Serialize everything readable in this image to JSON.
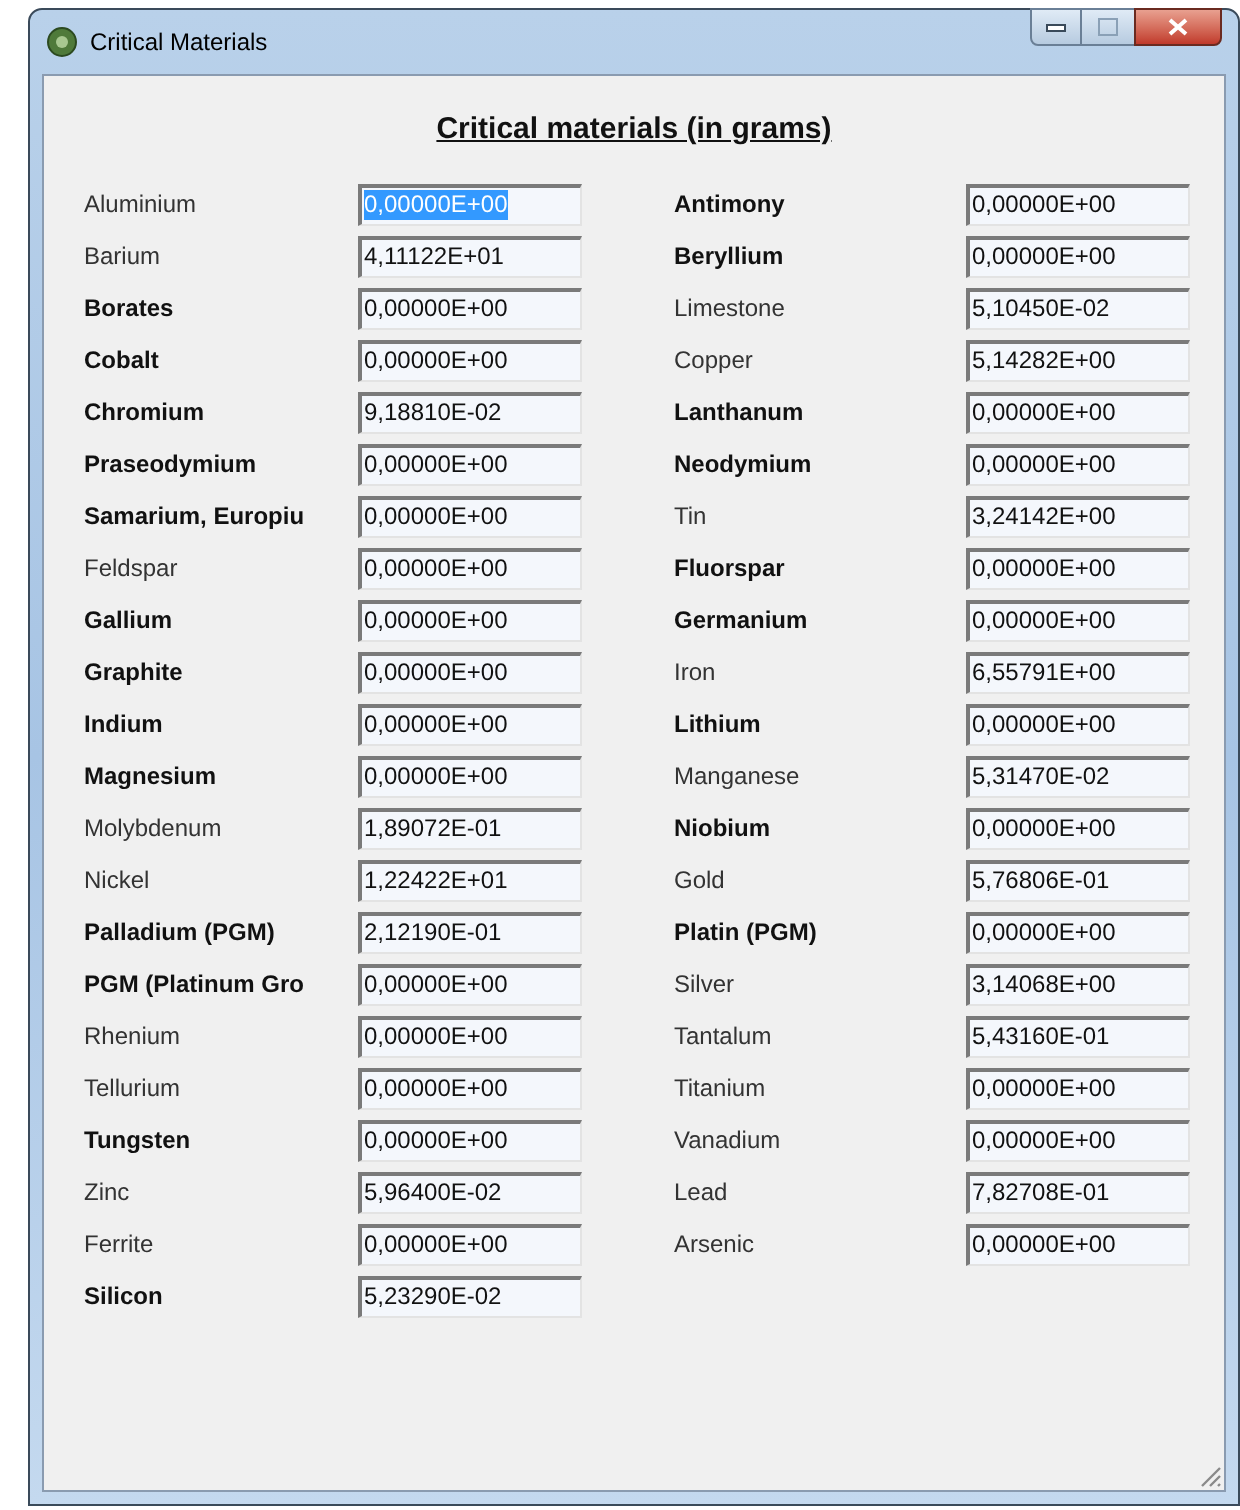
{
  "window": {
    "title": "Critical Materials"
  },
  "heading": "Critical materials (in grams)",
  "left_column": [
    {
      "name": "Aluminium",
      "bold": false,
      "value": "0,00000E+00",
      "selected": true
    },
    {
      "name": "Barium",
      "bold": false,
      "value": "4,11122E+01",
      "selected": false
    },
    {
      "name": "Borates",
      "bold": true,
      "value": "0,00000E+00",
      "selected": false
    },
    {
      "name": "Cobalt",
      "bold": true,
      "value": "0,00000E+00",
      "selected": false
    },
    {
      "name": "Chromium",
      "bold": true,
      "value": "9,18810E-02",
      "selected": false
    },
    {
      "name": "Praseodymium",
      "bold": true,
      "value": "0,00000E+00",
      "selected": false
    },
    {
      "name": "Samarium, Europiu",
      "bold": true,
      "value": "0,00000E+00",
      "selected": false
    },
    {
      "name": "Feldspar",
      "bold": false,
      "value": "0,00000E+00",
      "selected": false
    },
    {
      "name": "Gallium",
      "bold": true,
      "value": "0,00000E+00",
      "selected": false
    },
    {
      "name": "Graphite",
      "bold": true,
      "value": "0,00000E+00",
      "selected": false
    },
    {
      "name": "Indium",
      "bold": true,
      "value": "0,00000E+00",
      "selected": false
    },
    {
      "name": "Magnesium",
      "bold": true,
      "value": "0,00000E+00",
      "selected": false
    },
    {
      "name": "Molybdenum",
      "bold": false,
      "value": "1,89072E-01",
      "selected": false
    },
    {
      "name": "Nickel",
      "bold": false,
      "value": "1,22422E+01",
      "selected": false
    },
    {
      "name": "Palladium (PGM)",
      "bold": true,
      "value": "2,12190E-01",
      "selected": false
    },
    {
      "name": "PGM (Platinum Gro",
      "bold": true,
      "value": "0,00000E+00",
      "selected": false
    },
    {
      "name": "Rhenium",
      "bold": false,
      "value": "0,00000E+00",
      "selected": false
    },
    {
      "name": "Tellurium",
      "bold": false,
      "value": "0,00000E+00",
      "selected": false
    },
    {
      "name": "Tungsten",
      "bold": true,
      "value": "0,00000E+00",
      "selected": false
    },
    {
      "name": "Zinc",
      "bold": false,
      "value": "5,96400E-02",
      "selected": false
    },
    {
      "name": "Ferrite",
      "bold": false,
      "value": "0,00000E+00",
      "selected": false
    },
    {
      "name": "Silicon",
      "bold": true,
      "value": "5,23290E-02",
      "selected": false
    }
  ],
  "right_column": [
    {
      "name": "Antimony",
      "bold": true,
      "value": "0,00000E+00",
      "selected": false
    },
    {
      "name": "Beryllium",
      "bold": true,
      "value": "0,00000E+00",
      "selected": false
    },
    {
      "name": "Limestone",
      "bold": false,
      "value": "5,10450E-02",
      "selected": false
    },
    {
      "name": "Copper",
      "bold": false,
      "value": "5,14282E+00",
      "selected": false
    },
    {
      "name": "Lanthanum",
      "bold": true,
      "value": "0,00000E+00",
      "selected": false
    },
    {
      "name": "Neodymium",
      "bold": true,
      "value": "0,00000E+00",
      "selected": false
    },
    {
      "name": "Tin",
      "bold": false,
      "value": "3,24142E+00",
      "selected": false
    },
    {
      "name": "Fluorspar",
      "bold": true,
      "value": "0,00000E+00",
      "selected": false
    },
    {
      "name": "Germanium",
      "bold": true,
      "value": "0,00000E+00",
      "selected": false
    },
    {
      "name": "Iron",
      "bold": false,
      "value": "6,55791E+00",
      "selected": false
    },
    {
      "name": "Lithium",
      "bold": true,
      "value": "0,00000E+00",
      "selected": false
    },
    {
      "name": "Manganese",
      "bold": false,
      "value": "5,31470E-02",
      "selected": false
    },
    {
      "name": "Niobium",
      "bold": true,
      "value": "0,00000E+00",
      "selected": false
    },
    {
      "name": "Gold",
      "bold": false,
      "value": "5,76806E-01",
      "selected": false
    },
    {
      "name": "Platin (PGM)",
      "bold": true,
      "value": "0,00000E+00",
      "selected": false
    },
    {
      "name": "Silver",
      "bold": false,
      "value": "3,14068E+00",
      "selected": false
    },
    {
      "name": "Tantalum",
      "bold": false,
      "value": "5,43160E-01",
      "selected": false
    },
    {
      "name": "Titanium",
      "bold": false,
      "value": "0,00000E+00",
      "selected": false
    },
    {
      "name": "Vanadium",
      "bold": false,
      "value": "0,00000E+00",
      "selected": false
    },
    {
      "name": "Lead",
      "bold": false,
      "value": "7,82708E-01",
      "selected": false
    },
    {
      "name": "Arsenic",
      "bold": false,
      "value": "0,00000E+00",
      "selected": false
    }
  ]
}
